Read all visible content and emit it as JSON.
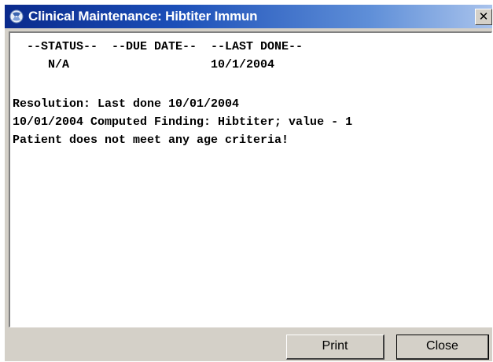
{
  "window": {
    "title": "Clinical Maintenance: Hibtiter Immun",
    "close_glyph": "✕"
  },
  "report": {
    "header_line": "  --STATUS--  --DUE DATE--  --LAST DONE--",
    "values_line": "     N/A                    10/1/2004",
    "resolution_line": "Resolution: Last done 10/01/2004",
    "finding_line": "10/01/2004 Computed Finding: Hibtiter; value - 1",
    "criteria_line": "Patient does not meet any age criteria!"
  },
  "buttons": {
    "print_label": "Print",
    "close_label": "Close"
  },
  "colors": {
    "titlebar_start": "#0a2a8c",
    "titlebar_end": "#a9c3ec",
    "face": "#d4d0c8"
  },
  "icons": {
    "app": "app-icon",
    "close": "close-icon"
  }
}
